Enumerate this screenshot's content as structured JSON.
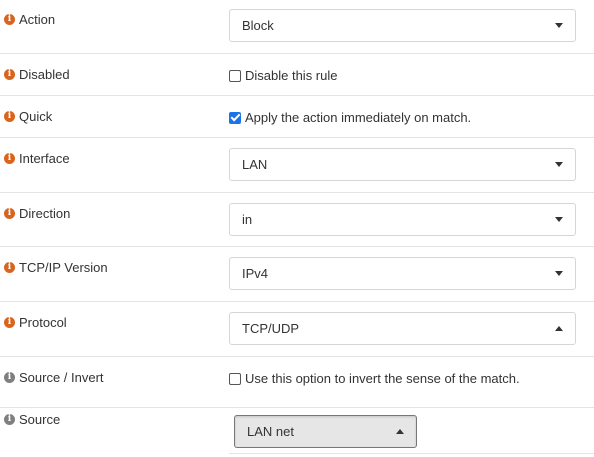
{
  "fields": {
    "action": {
      "label": "Action",
      "value": "Block",
      "icon": "info-icon"
    },
    "disabled": {
      "label": "Disabled",
      "checkbox_label": "Disable this rule",
      "checked": false,
      "icon": "info-icon"
    },
    "quick": {
      "label": "Quick",
      "checkbox_label": "Apply the action immediately on match.",
      "checked": true,
      "icon": "info-icon"
    },
    "interface": {
      "label": "Interface",
      "value": "LAN",
      "icon": "info-icon"
    },
    "direction": {
      "label": "Direction",
      "value": "in",
      "icon": "info-icon"
    },
    "tcpip_version": {
      "label": "TCP/IP Version",
      "value": "IPv4",
      "icon": "info-icon"
    },
    "protocol": {
      "label": "Protocol",
      "value": "TCP/UDP",
      "icon": "info-icon"
    },
    "source_invert": {
      "label": "Source / Invert",
      "checkbox_label": "Use this option to invert the sense of the match.",
      "checked": false,
      "icon": "info-icon"
    },
    "source": {
      "label": "Source",
      "value": "LAN net",
      "icon": "info-icon"
    }
  },
  "colors": {
    "info_icon_primary": "#d9641e",
    "info_icon_secondary": "#7f7f7f",
    "checkbox_checked": "#1a73e8"
  }
}
